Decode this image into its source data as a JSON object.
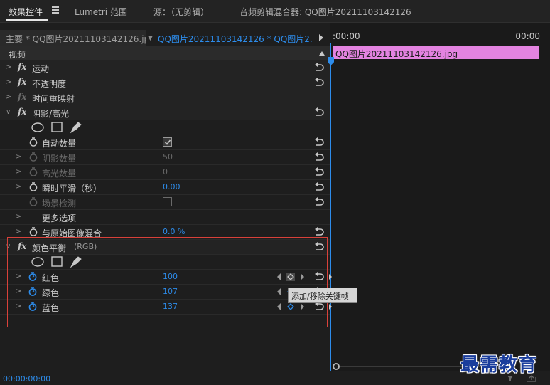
{
  "tabs": [
    {
      "label": "效果控件",
      "active": true
    },
    {
      "label": "Lumetri 范围"
    },
    {
      "label": "源：（无剪辑）"
    },
    {
      "label": "音频剪辑混合器: QQ图片20211103142126"
    }
  ],
  "source": {
    "main_label": "主要 * QQ图片20211103142126.jpg",
    "clip_label": "QQ图片20211103142126 * QQ图片2..."
  },
  "section_title": "视频",
  "effects": {
    "motion": "运动",
    "opacity": "不透明度",
    "time_remap": "时间重映射",
    "shadow_highlight": {
      "title": "阴影/高光",
      "auto_amount": {
        "label": "自动数量",
        "checked": true
      },
      "shadow_amount": {
        "label": "阴影数量",
        "value": "50"
      },
      "highlight_amount": {
        "label": "高光数量",
        "value": "0"
      },
      "temporal_smooth": {
        "label": "瞬时平滑（秒）",
        "value": "0.00"
      },
      "scene_detect": {
        "label": "场景检测",
        "checked": false
      },
      "more_options": {
        "label": "更多选项"
      },
      "blend_original": {
        "label": "与原始图像混合",
        "value": "0.0 %"
      }
    },
    "color_balance": {
      "title": "颜色平衡",
      "suffix": "(RGB)",
      "red": {
        "label": "红色",
        "value": "100"
      },
      "green": {
        "label": "绿色",
        "value": "107"
      },
      "blue": {
        "label": "蓝色",
        "value": "137"
      }
    }
  },
  "tooltip": "添加/移除关键帧",
  "timeline": {
    "start_time": ":00:00",
    "end_time": "00:00",
    "clip_name": "QQ图片20211103142126.jpg",
    "clip_color": "#e383e0"
  },
  "footer": {
    "timecode": "00:00:00:00"
  },
  "watermark": "最需教育",
  "colors": {
    "accent": "#2d8ceb",
    "highlight_box": "#d9413a"
  }
}
